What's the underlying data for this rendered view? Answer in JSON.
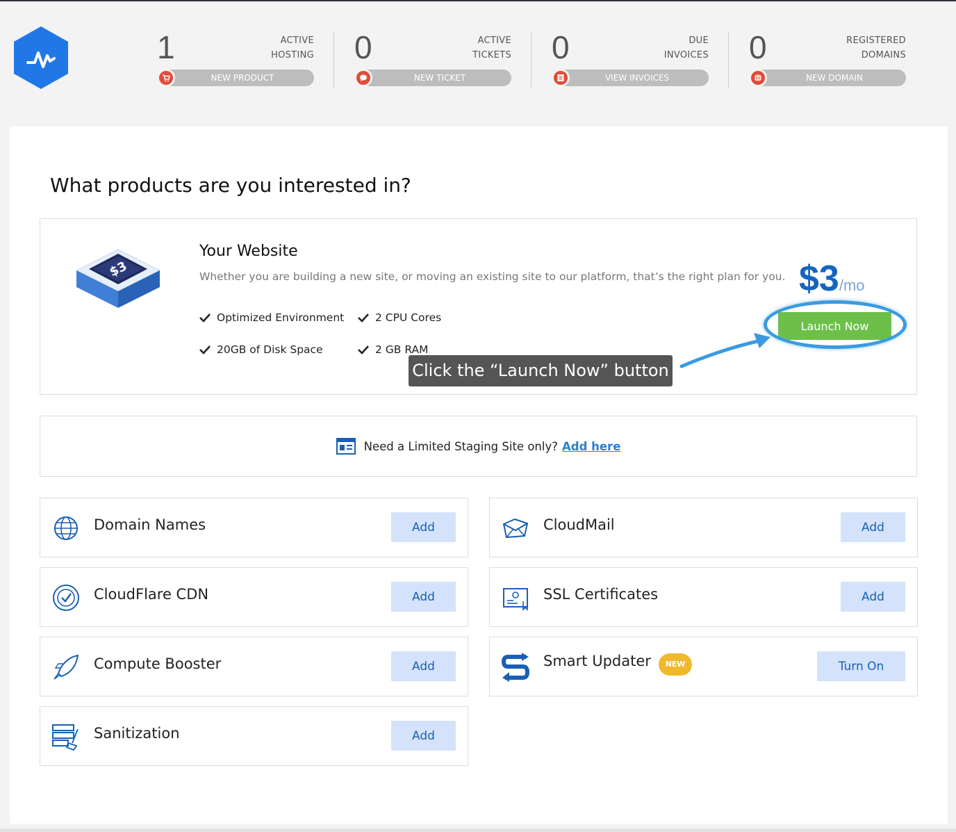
{
  "stats": [
    {
      "value": "1",
      "label_line1": "ACTIVE",
      "label_line2": "HOSTING",
      "button": "NEW PRODUCT",
      "icon": "cart-icon"
    },
    {
      "value": "0",
      "label_line1": "ACTIVE",
      "label_line2": "TICKETS",
      "button": "NEW TICKET",
      "icon": "chat-icon"
    },
    {
      "value": "0",
      "label_line1": "DUE",
      "label_line2": "INVOICES",
      "button": "VIEW INVOICES",
      "icon": "list-icon"
    },
    {
      "value": "0",
      "label_line1": "REGISTERED",
      "label_line2": "DOMAINS",
      "button": "NEW DOMAIN",
      "icon": "globe-icon"
    }
  ],
  "main": {
    "title": "What products are you interested in?",
    "website": {
      "title": "Your Website",
      "description": "Whether you are building a new site, or moving an existing site to our platform, that’s the right plan for you.",
      "features": [
        "Optimized Environment",
        "2 CPU Cores",
        "20GB of Disk Space",
        "2 GB RAM"
      ],
      "price": "$3",
      "price_unit": "/mo",
      "launch_label": "Launch Now",
      "tooltip": "Click the “Launch Now” button"
    },
    "staging": {
      "text": "Need a Limited Staging Site only?",
      "link": "Add here"
    },
    "products": [
      {
        "name": "Domain Names",
        "button": "Add",
        "icon": "globe-icon"
      },
      {
        "name": "CloudMail",
        "button": "Add",
        "icon": "mail-icon"
      },
      {
        "name": "CloudFlare CDN",
        "button": "Add",
        "icon": "check-circle-icon"
      },
      {
        "name": "SSL Certificates",
        "button": "Add",
        "icon": "certificate-icon"
      },
      {
        "name": "Compute Booster",
        "button": "Add",
        "icon": "rocket-icon"
      },
      {
        "name": "Smart Updater",
        "button": "Turn On",
        "badge": "NEW",
        "icon": "updater-icon"
      },
      {
        "name": "Sanitization",
        "button": "Add",
        "icon": "server-broom-icon"
      }
    ]
  },
  "colors": {
    "accent_blue": "#1565c0",
    "launch_green": "#6cc04a",
    "pill_gray": "#bdbdbd",
    "icon_red": "#e04b3a",
    "add_button_bg": "#d4e3fb",
    "badge_yellow": "#f0b92c"
  }
}
